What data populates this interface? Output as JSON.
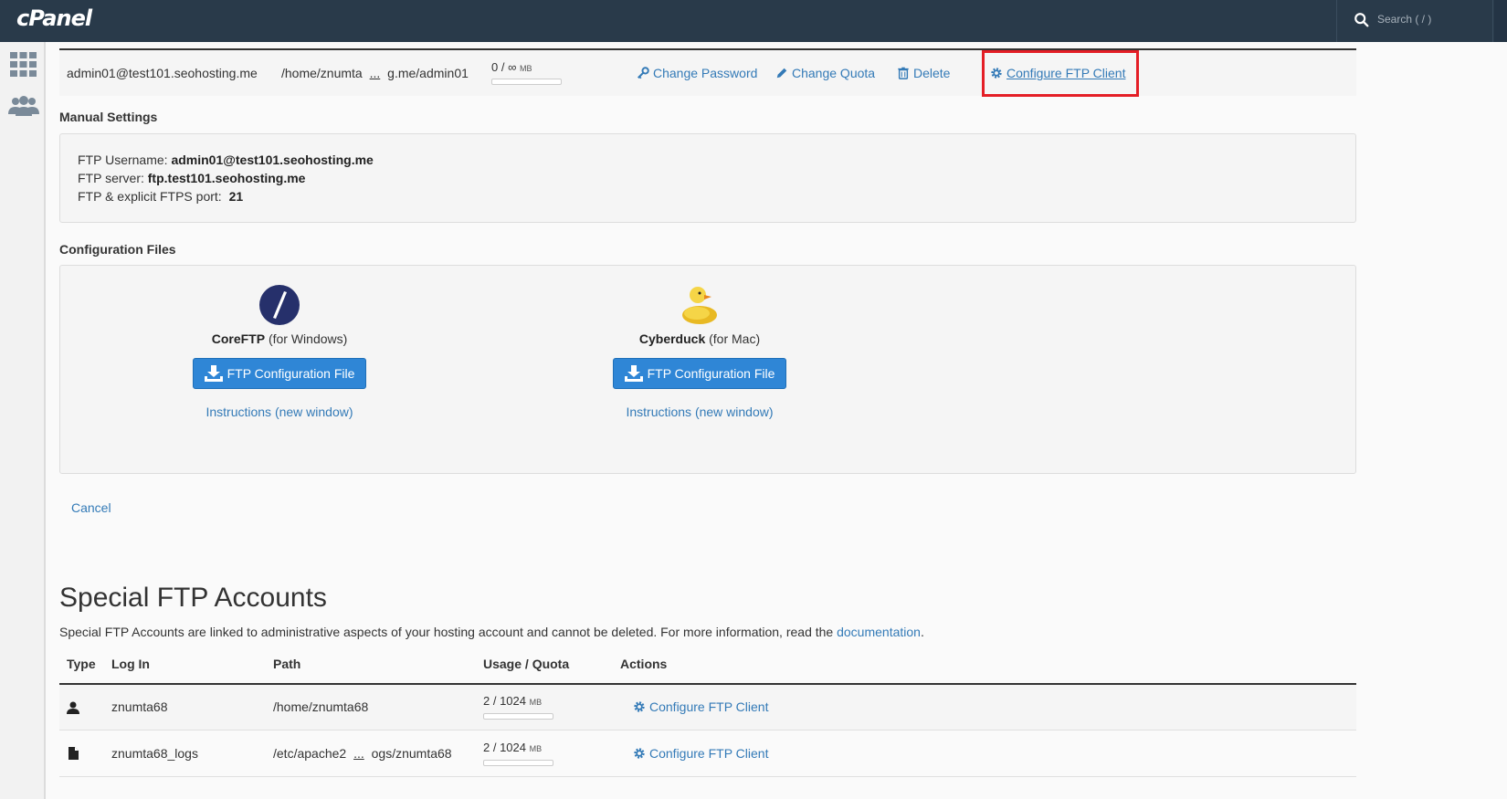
{
  "header": {
    "logo": "cPanel",
    "search_placeholder": "Search ( / )"
  },
  "account": {
    "login": "admin01@test101.seohosting.me",
    "path_start": "/home/znumta",
    "path_ellipsis": "...",
    "path_end": "g.me/admin01",
    "usage": "0 / ∞",
    "usage_unit": "MB",
    "actions": {
      "change_password": "Change Password",
      "change_quota": "Change Quota",
      "delete": "Delete",
      "configure": "Configure FTP Client"
    }
  },
  "manual": {
    "title": "Manual Settings",
    "username_label": "FTP Username:",
    "username_value": "admin01@test101.seohosting.me",
    "server_label": "FTP server:",
    "server_value": "ftp.test101.seohosting.me",
    "port_label": "FTP & explicit FTPS port:",
    "port_value": "21"
  },
  "config_files": {
    "title": "Configuration Files",
    "clients": [
      {
        "name": "CoreFTP",
        "platform": "(for Windows)",
        "button": "FTP Configuration File",
        "instructions": "Instructions (new window)"
      },
      {
        "name": "Cyberduck",
        "platform": "(for Mac)",
        "button": "FTP Configuration File",
        "instructions": "Instructions (new window)"
      }
    ]
  },
  "cancel_label": "Cancel",
  "special": {
    "title": "Special FTP Accounts",
    "description": "Special FTP Accounts are linked to administrative aspects of your hosting account and cannot be deleted. For more information, read the ",
    "doc_link": "documentation",
    "desc_end": ".",
    "columns": [
      "Type",
      "Log In",
      "Path",
      "Usage / Quota",
      "Actions"
    ],
    "rows": [
      {
        "login": "znumta68",
        "path": "/home/znumta68",
        "path_ellipsis": "",
        "path_end": "",
        "usage": "2 / 1024",
        "unit": "MB",
        "action": "Configure FTP Client"
      },
      {
        "login": "znumta68_logs",
        "path": "/etc/apache2",
        "path_ellipsis": "...",
        "path_end": "ogs/znumta68",
        "usage": "2 / 1024",
        "unit": "MB",
        "action": "Configure FTP Client"
      }
    ]
  },
  "colors": {
    "topbar": "#293a4a",
    "link": "#337ab7",
    "button": "#2f86d6",
    "highlight": "#e41e26"
  }
}
